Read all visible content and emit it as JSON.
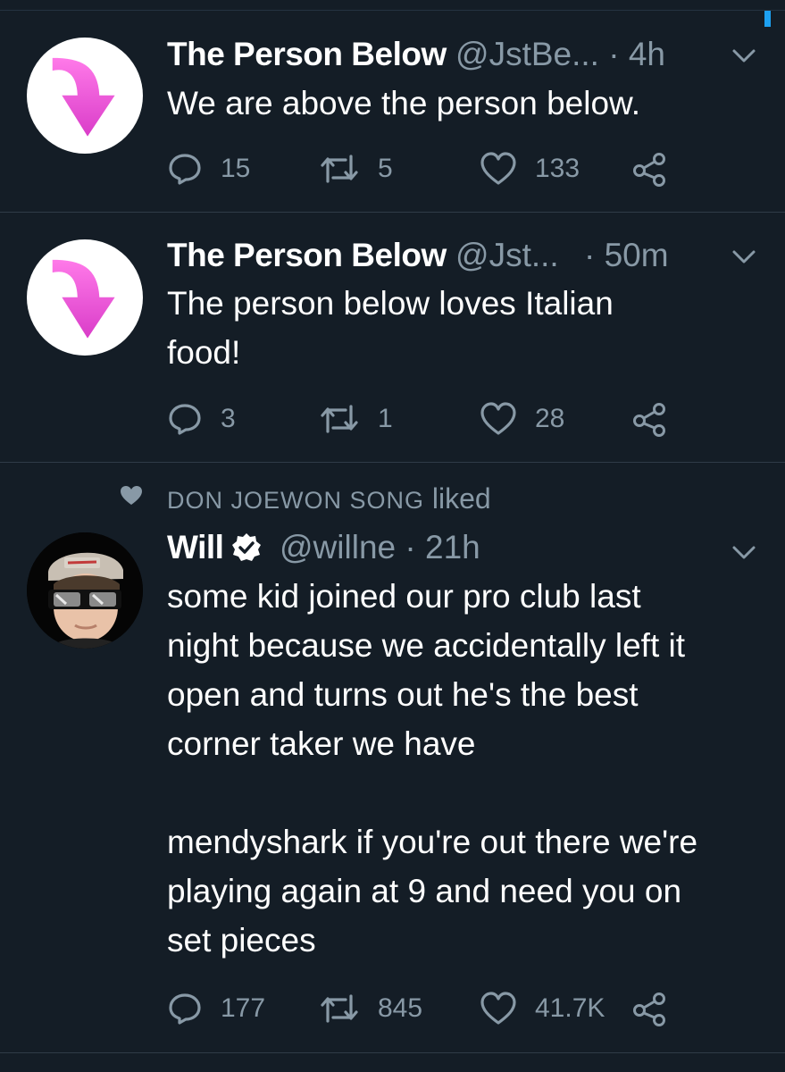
{
  "tweets": [
    {
      "name": "The Person Below",
      "handle": "@JstBe...",
      "sep": " · ",
      "time": "4h",
      "text": "We are above the person below.",
      "replies": "15",
      "retweets": "5",
      "likes": "133",
      "avatar_icon": "pink-down-arrow-icon"
    },
    {
      "name": "The Person Below",
      "handle": "@Jst...",
      "sep": " · ",
      "time": "50m",
      "text": "The person below loves Italian\nfood!",
      "replies": "3",
      "retweets": "1",
      "likes": "28",
      "avatar_icon": "pink-down-arrow-icon"
    },
    {
      "social_context_name": "DON JOEWON SONG",
      "social_context_action": "liked",
      "name": "Will",
      "verified": true,
      "handle": "@willne",
      "sep": " · ",
      "time": "21h",
      "text": "some kid joined our pro club last\nnight because we accidentally left it\nopen and turns out he's the best\ncorner taker we have\n\nmendyshark if you're out there we're\nplaying again at 9 and need you on\nset pieces",
      "replies": "177",
      "retweets": "845",
      "likes": "41.7K",
      "avatar_icon": "person-with-glasses-icon"
    }
  ],
  "colors": {
    "background": "#141d26",
    "text": "#ffffff",
    "muted": "#8899a6",
    "divider": "#2f3b47",
    "accent": "#1da1f2",
    "arrow_pink": "#e84fd6"
  }
}
